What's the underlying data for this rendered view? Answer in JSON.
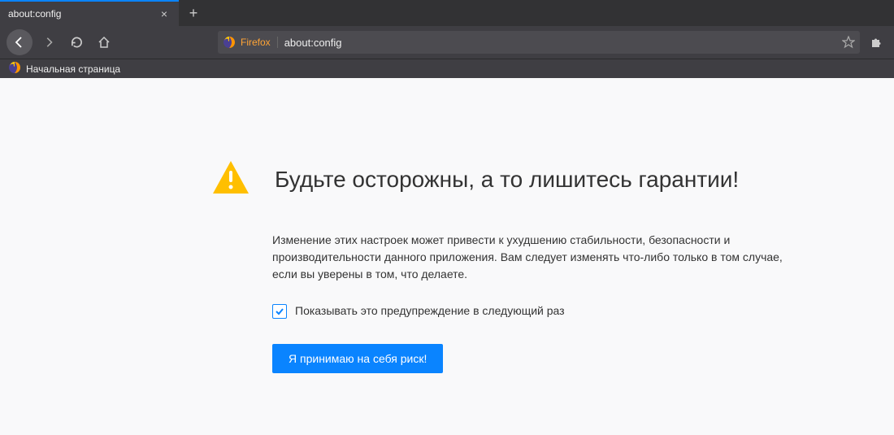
{
  "tab": {
    "title": "about:config"
  },
  "urlbar": {
    "brand": "Firefox",
    "url": "about:config"
  },
  "bookmarks": {
    "home_label": "Начальная страница"
  },
  "warning": {
    "title": "Будьте осторожны, а то лишитесь гарантии!",
    "body": "Изменение этих настроек может привести к ухудшению стабильности, безопасности и производительности данного приложения. Вам следует изменять что-либо только в том случае, если вы уверены в том, что делаете.",
    "checkbox_label": "Показывать это предупреждение в следующий раз",
    "accept_label": "Я принимаю на себя риск!"
  },
  "colors": {
    "accent": "#0a84ff",
    "warning_icon": "#ffbf00"
  }
}
